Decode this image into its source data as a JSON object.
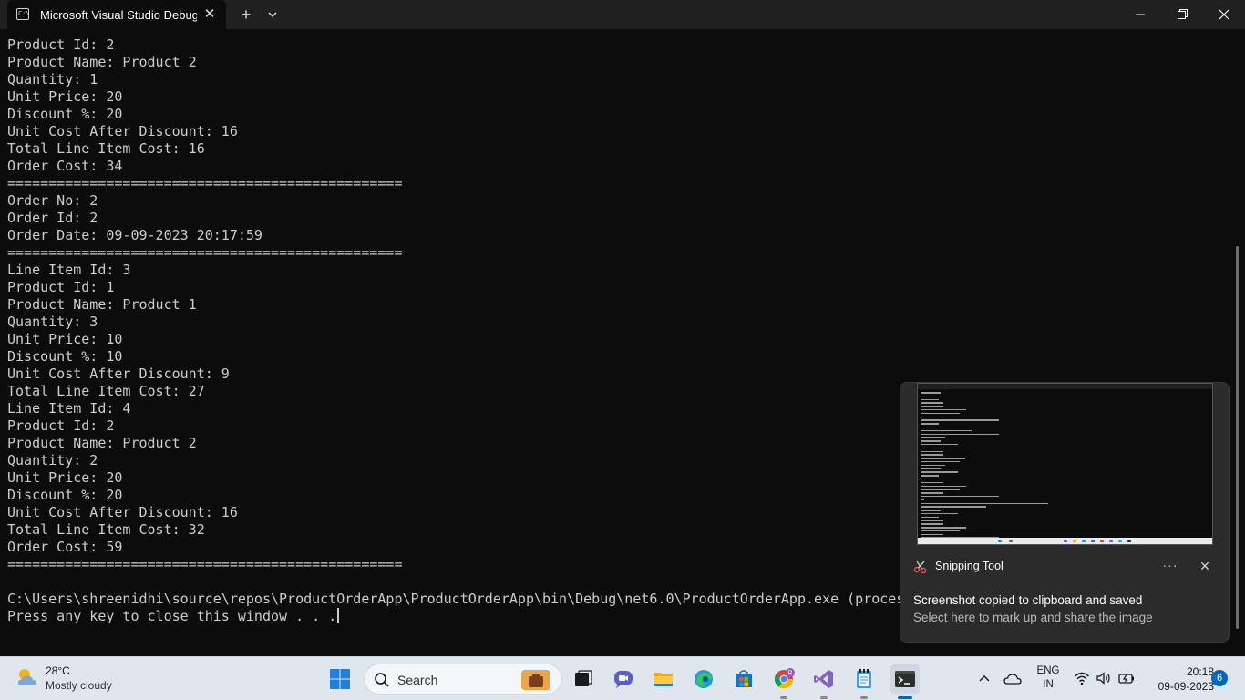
{
  "window": {
    "tab_title": "Microsoft Visual Studio Debug",
    "tab_icon_glyph": "C:\\",
    "tab_close_glyph": "✕",
    "new_tab_glyph": "+"
  },
  "console": {
    "lines": [
      "Product Id: 2",
      "Product Name: Product 2",
      "Quantity: 1",
      "Unit Price: 20",
      "Discount %: 20",
      "Unit Cost After Discount: 16",
      "Total Line Item Cost: 16",
      "Order Cost: 34",
      "================================================",
      "Order No: 2",
      "Order Id: 2",
      "Order Date: 09-09-2023 20:17:59",
      "================================================",
      "Line Item Id: 3",
      "Product Id: 1",
      "Product Name: Product 1",
      "Quantity: 3",
      "Unit Price: 10",
      "Discount %: 10",
      "Unit Cost After Discount: 9",
      "Total Line Item Cost: 27",
      "Line Item Id: 4",
      "Product Id: 2",
      "Product Name: Product 2",
      "Quantity: 2",
      "Unit Price: 20",
      "Discount %: 20",
      "Unit Cost After Discount: 16",
      "Total Line Item Cost: 32",
      "Order Cost: 59",
      "================================================",
      "",
      "C:\\Users\\shreenidhi\\source\\repos\\ProductOrderApp\\ProductOrderApp\\bin\\Debug\\net6.0\\ProductOrderApp.exe (proces",
      "Press any key to close this window . . ."
    ]
  },
  "toast": {
    "app_name": "Snipping Tool",
    "more_glyph": "···",
    "close_glyph": "✕",
    "heading": "Screenshot copied to clipboard and saved",
    "body": "Select here to mark up and share the image"
  },
  "taskbar": {
    "weather_temp": "28°C",
    "weather_desc": "Mostly cloudy",
    "search_placeholder": "Search",
    "apps": [
      "task-view",
      "teams-chat",
      "file-explorer",
      "edge",
      "microsoft-store",
      "chrome",
      "visual-studio",
      "notepad",
      "terminal"
    ],
    "chrome_profile_initial": "R",
    "lang_line1": "ENG",
    "lang_line2": "IN",
    "time": "20:18",
    "date": "09-09-2023",
    "notification_count": "6"
  },
  "colors": {
    "console_bg": "#0c0c0c",
    "console_text": "#cccccc",
    "titlebar_bg": "#202020",
    "taskbar_bg": "#dfe6ee",
    "accent": "#0067c0"
  }
}
